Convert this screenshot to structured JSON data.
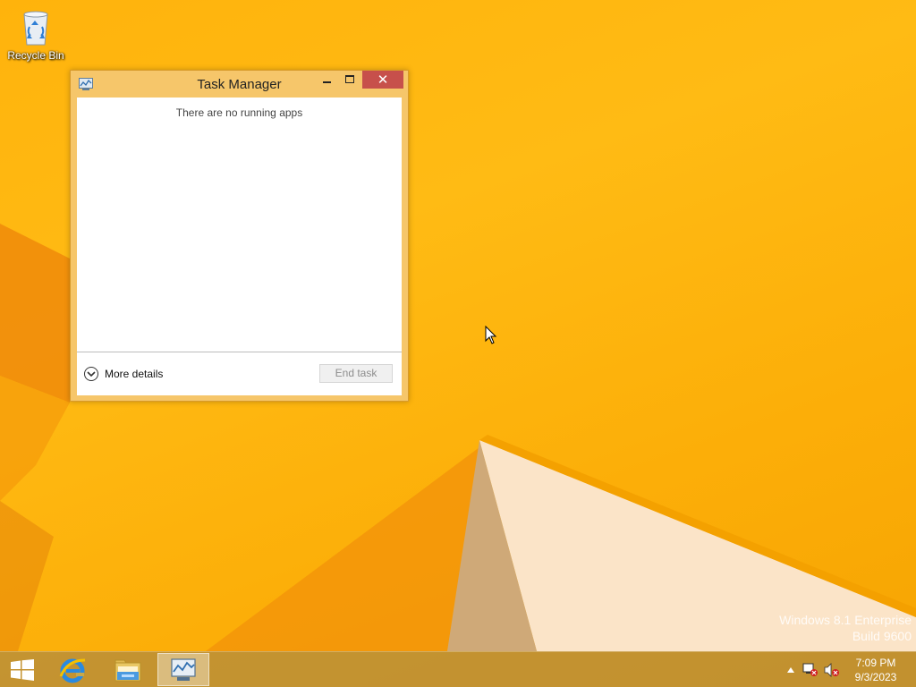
{
  "desktop": {
    "icons": [
      {
        "label": "Recycle Bin",
        "icon": "recycle-bin-icon"
      }
    ],
    "watermark": {
      "line1": "Windows 8.1 Enterprise",
      "line2": "Build 9600"
    },
    "colors": {
      "wallpaper_primary": "#ffb30c",
      "wallpaper_highlight": "#fbe4c8"
    }
  },
  "window": {
    "title": "Task Manager",
    "title_icon": "task-manager-icon",
    "close_glyph": "✕",
    "empty_message": "There are no running apps",
    "more_details_label": "More details",
    "end_task_label": "End task",
    "colors": {
      "frame": "#f6c66a",
      "close_button": "#c7504b"
    }
  },
  "taskbar": {
    "pinned": [
      {
        "name": "Start",
        "icon": "windows-start-icon"
      },
      {
        "name": "Internet Explorer",
        "icon": "internet-explorer-icon"
      },
      {
        "name": "File Explorer",
        "icon": "file-explorer-icon"
      },
      {
        "name": "Task Manager",
        "icon": "task-manager-icon",
        "active": true
      }
    ],
    "tray": {
      "icons": [
        "show-hidden-icons-arrow-icon",
        "network-disconnected-icon",
        "volume-muted-icon"
      ],
      "time": "7:09 PM",
      "date": "9/3/2023"
    }
  }
}
